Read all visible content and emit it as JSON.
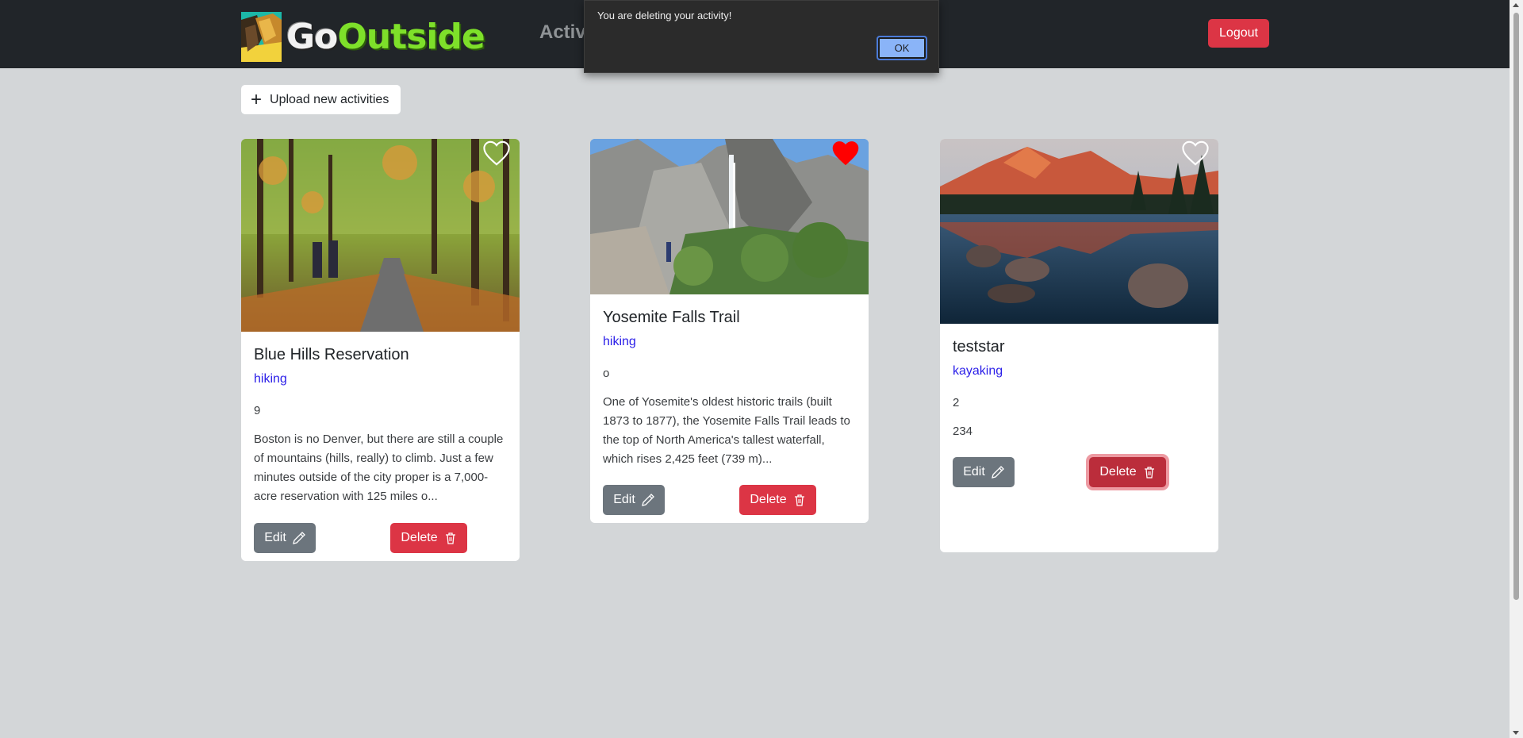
{
  "app": {
    "logo_text_go": "Go",
    "logo_text_outside": "Outside",
    "nav_link": "Activities",
    "logout_label": "Logout"
  },
  "dialog": {
    "message": "You are deleting your activity!",
    "ok_label": "OK"
  },
  "toolbar": {
    "upload_label": "Upload new activities"
  },
  "cards": [
    {
      "title": "Blue Hills Reservation",
      "category": "hiking",
      "number": "9",
      "description": "Boston is no Denver, but there are still a couple of mountains (hills, really) to climb. Just a few minutes outside of the city proper is a 7,000-acre reservation with 125 miles o...",
      "favorited": false,
      "edit_label": "Edit",
      "delete_label": "Delete"
    },
    {
      "title": "Yosemite Falls Trail",
      "category": "hiking",
      "number": "o",
      "description": "One of Yosemite's oldest historic trails (built 1873 to 1877), the Yosemite Falls Trail leads to the top of North America's tallest waterfall, which rises 2,425 feet (739 m)...",
      "favorited": true,
      "edit_label": "Edit",
      "delete_label": "Delete"
    },
    {
      "title": "teststar",
      "category": "kayaking",
      "number": "2",
      "description": "234",
      "favorited": false,
      "edit_label": "Edit",
      "delete_label": "Delete"
    }
  ],
  "colors": {
    "navbar": "#212529",
    "background": "#d3d6d8",
    "danger": "#dc3545",
    "secondary": "#6c757d",
    "category_link": "#2a1ee8",
    "heart_filled": "#ff0000"
  }
}
